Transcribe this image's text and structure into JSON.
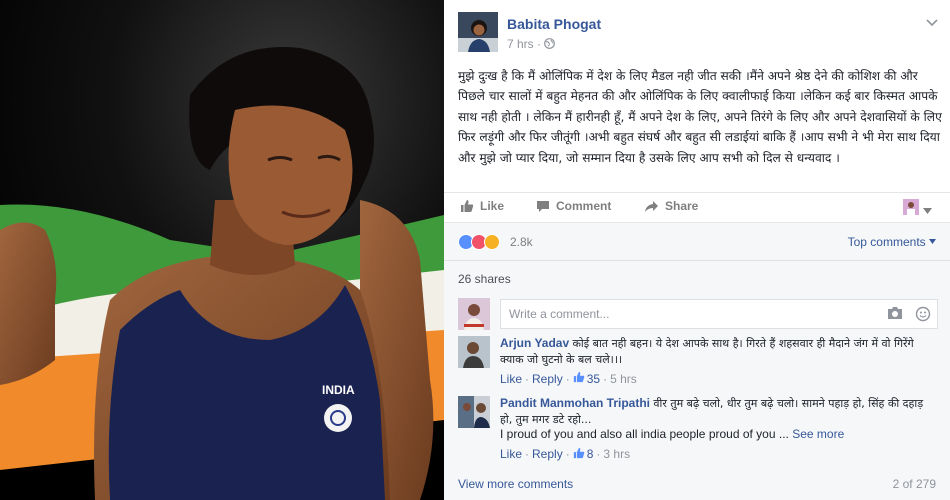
{
  "post": {
    "page_name": "Babita Phogat",
    "time": "7 hrs",
    "time_separator": "·",
    "text": "मुझे दुःख है कि मैं ओलिंपिक में देश के लिए मैडल नही जीत सकी ।मैंने अपने श्रेष्ठ देने की कोशिश की और पिछले चार सालों में बहुत मेहनत की और ओलिंपिक के लिए क्वालीफाई किया ।लेकिन कई बार किस्मत आपके साथ नही होती । लेकिन मैं हारीनही हूँ, मैं अपने देश के लिए, अपने तिरंगे के लिए और अपने देशवासियों के लिए फिर लड़ूंगी और फिर जीतूंगी ।अभी बहुत संघर्ष और बहुत सी लडाईयां बाकि हैं ।आप सभी ने भी मेरा साथ दिया और मुझे जो प्यार दिया, जो सम्मान दिया है उसके लिए आप सभी को दिल से धन्यवाद ।"
  },
  "actions": {
    "like": "Like",
    "comment": "Comment",
    "share": "Share"
  },
  "reactions": {
    "count": "2.8k",
    "top_comments": "Top comments"
  },
  "shares": "26 shares",
  "comment_input": {
    "placeholder": "Write a comment..."
  },
  "comments": [
    {
      "author": "Arjun Yadav",
      "text": "कोई बात नही बहन। ये देश आपके साथ है। गिरते हैं शहसवार ही मैदाने जंग में वो गिरेंगे क्याक जो घुटनो के बल चले।।।",
      "like": "Like",
      "reply": "Reply",
      "likes": "35",
      "time": "5 hrs",
      "dot": "·"
    },
    {
      "author": "Pandit Manmohan Tripathi",
      "text": "वीर तुम बढ़े चलो, धीर तुम बढ़े चलो। सामने पहाड़ हो, सिंह की दहाड़ हो, तुम मगर डटे रहो...",
      "text_en": "I proud of you and also all india people proud of you ...",
      "see_more": "See more",
      "like": "Like",
      "reply": "Reply",
      "likes": "8",
      "time": "3 hrs",
      "dot": "·"
    }
  ],
  "footer": {
    "view_more": "View more comments",
    "paging": "2 of 279"
  },
  "photo": {
    "singlet_text": "INDIA"
  },
  "colors": {
    "link": "#365899",
    "like_blue": "#5890ff",
    "love_red": "#f25268",
    "wow_yellow": "#f7b125"
  }
}
